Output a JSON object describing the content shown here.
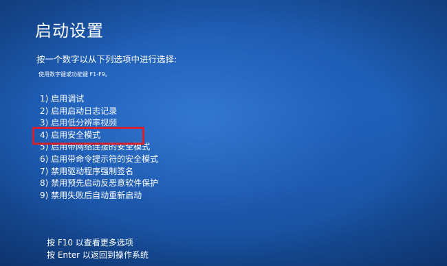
{
  "screen": {
    "title": "启动设置",
    "instruction": "按一个数字以从下列选项中进行选择:",
    "hint": "使用数字键或功能键 F1-F9。",
    "background_color": "#1f5fb3",
    "text_color": "#ffffff",
    "highlight_color": "#d42030"
  },
  "options": [
    {
      "number": "1)",
      "label": "启用调试"
    },
    {
      "number": "2)",
      "label": "启用启动日志记录"
    },
    {
      "number": "3)",
      "label": "启用低分辨率视频"
    },
    {
      "number": "4)",
      "label": "启用安全模式",
      "highlighted": true
    },
    {
      "number": "5)",
      "label": "启用带网络连接的安全模式"
    },
    {
      "number": "6)",
      "label": "启用带命令提示符的安全模式"
    },
    {
      "number": "7)",
      "label": "禁用驱动程序强制签名"
    },
    {
      "number": "8)",
      "label": "禁用预先启动反恶意软件保护"
    },
    {
      "number": "9)",
      "label": "禁用失败后自动重新启动"
    }
  ],
  "footer": {
    "more_options": "按 F10 以查看更多选项",
    "return": "按 Enter 以返回到操作系统"
  }
}
